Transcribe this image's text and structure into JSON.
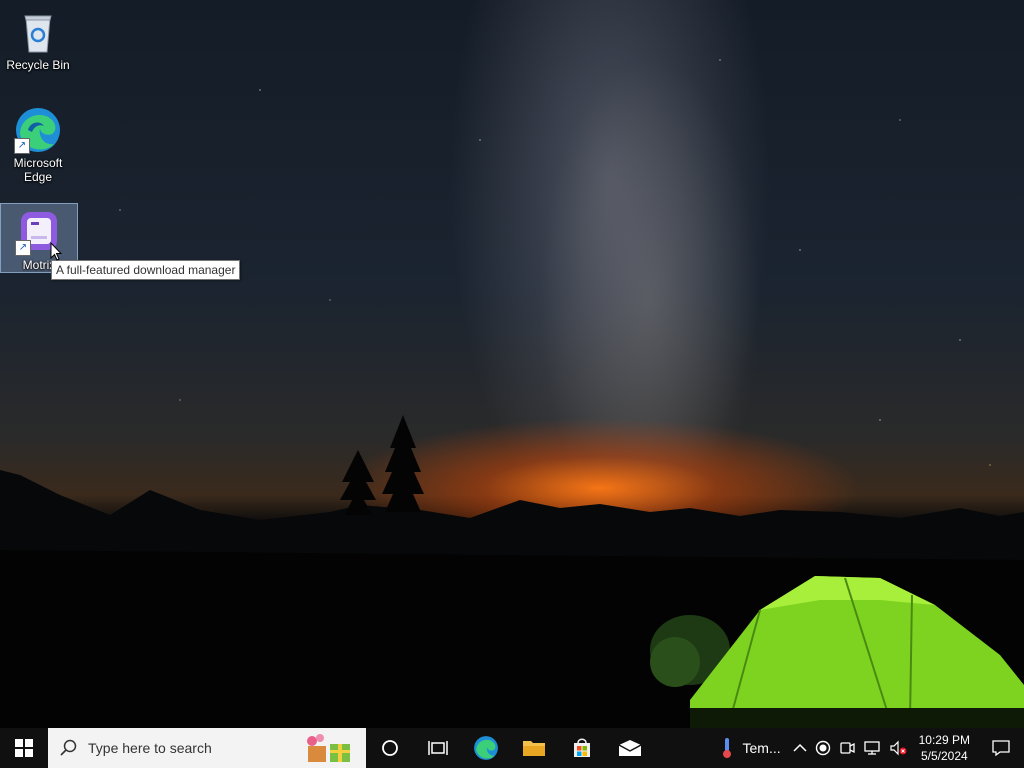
{
  "desktop": {
    "icons": [
      {
        "label": "Recycle Bin",
        "icon": "recycle-bin-icon"
      },
      {
        "label": "Microsoft Edge",
        "icon": "edge-icon"
      },
      {
        "label": "Motrix",
        "icon": "motrix-icon"
      }
    ],
    "tooltip": "A full-featured download manager"
  },
  "taskbar": {
    "search_placeholder": "Type here to search",
    "pinned": [
      "cortana-icon",
      "task-view-icon",
      "edge-icon",
      "file-explorer-icon",
      "store-icon",
      "mail-icon"
    ],
    "weather_label": "Tem...",
    "clock": {
      "time": "10:29 PM",
      "date": "5/5/2024"
    }
  },
  "colors": {
    "taskbar": "#101010",
    "search_bg": "#f3f3f3",
    "tent": "#7ed321",
    "horizon_glow": "#ff7a14"
  }
}
